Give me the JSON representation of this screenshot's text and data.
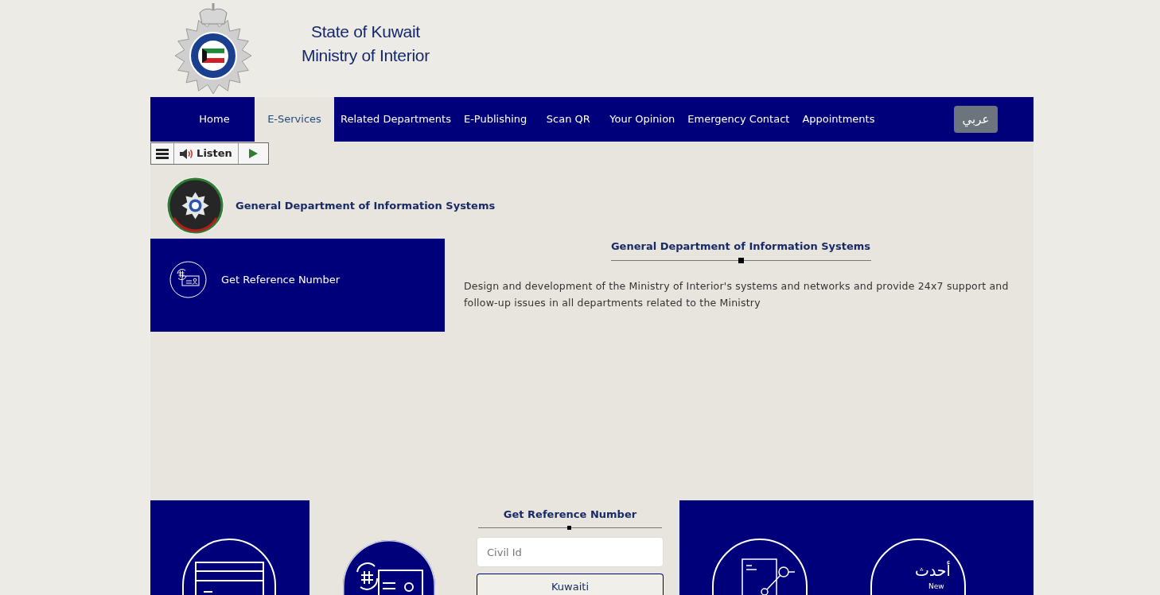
{
  "header": {
    "title_lines": [
      "State of Kuwait",
      "Ministry of Interior"
    ]
  },
  "nav": {
    "items": [
      {
        "label": "Home",
        "selected": false
      },
      {
        "label": "E-Services",
        "selected": true
      },
      {
        "label": "Related Departments",
        "selected": false
      },
      {
        "label": "E-Publishing",
        "selected": false
      },
      {
        "label": "Scan QR",
        "selected": false
      },
      {
        "label": "Your Opinion",
        "selected": false
      },
      {
        "label": "Emergency Contact",
        "selected": false
      },
      {
        "label": "Appointments",
        "selected": false
      }
    ],
    "language_button": "عربي"
  },
  "listen_toolbar": {
    "label": "Listen"
  },
  "department": {
    "name": "General Department of Information Systems"
  },
  "services": [
    {
      "label": "Get Reference Number"
    }
  ],
  "about": {
    "title": "General Department of Information Systems",
    "text": "Design and development of the Ministry of Interior's systems and networks and provide 24x7 support and follow-up issues in all departments related to the Ministry"
  },
  "reference_form": {
    "title": "Get Reference Number",
    "civil_id": {
      "placeholder": "Civil Id"
    },
    "buttons": [
      "Kuwaiti"
    ]
  },
  "latest_services_logo": {
    "arabic": "أحدث",
    "english": "New"
  }
}
